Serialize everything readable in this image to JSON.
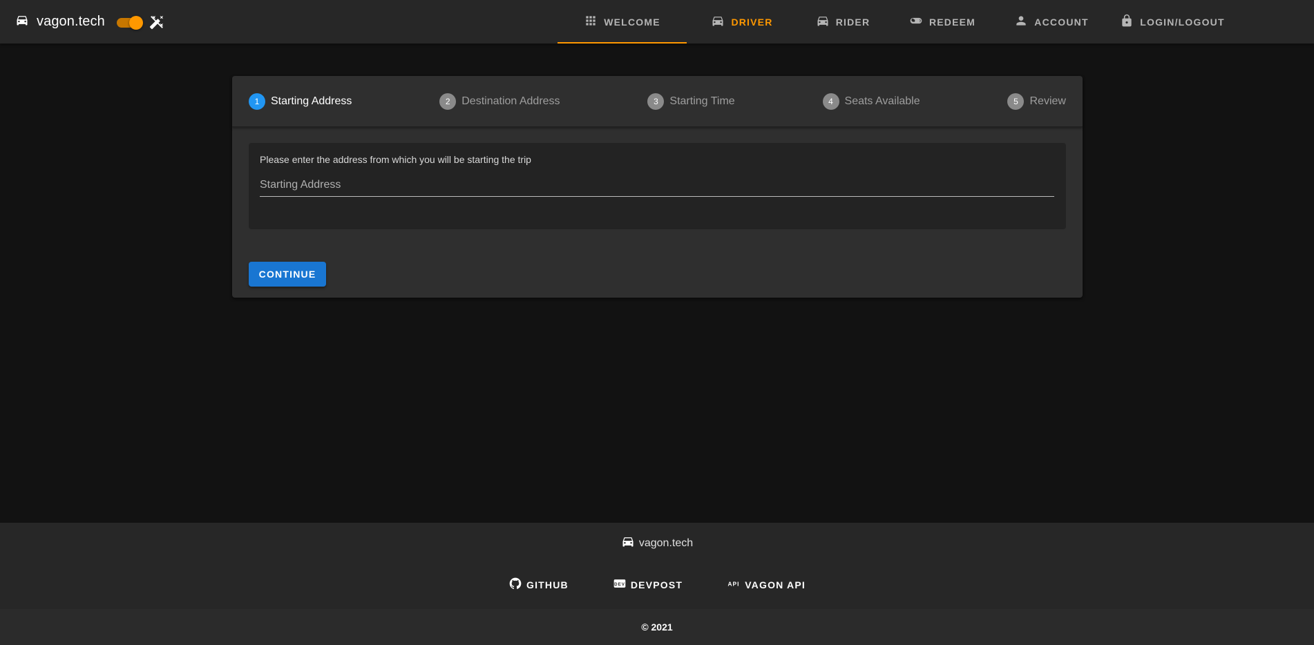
{
  "app": {
    "brand": "vagon.tech",
    "accent_color": "#ff9800",
    "primary_color": "#1976d2"
  },
  "nav": {
    "tabs": [
      {
        "label": "WELCOME",
        "icon": "grid-icon"
      },
      {
        "label": "DRIVER",
        "icon": "car-icon",
        "selected": true
      },
      {
        "label": "RIDER",
        "icon": "car-icon"
      },
      {
        "label": "REDEEM",
        "icon": "toggle-icon"
      },
      {
        "label": "ACCOUNT",
        "icon": "person-icon"
      },
      {
        "label": "LOGIN/LOGOUT",
        "icon": "lock-icon"
      }
    ]
  },
  "stepper": {
    "steps": [
      {
        "num": "1",
        "label": "Starting Address",
        "active": true
      },
      {
        "num": "2",
        "label": "Destination Address"
      },
      {
        "num": "3",
        "label": "Starting Time"
      },
      {
        "num": "4",
        "label": "Seats Available"
      },
      {
        "num": "5",
        "label": "Review"
      }
    ],
    "instruction": "Please enter the address from which you will be starting the trip",
    "input_placeholder": "Starting Address",
    "input_value": "",
    "continue_label": "CONTINUE"
  },
  "footer": {
    "brand": "vagon.tech",
    "links": [
      {
        "label": "GITHUB",
        "icon": "github-icon"
      },
      {
        "label": "DEVPOST",
        "icon": "devpost-icon"
      },
      {
        "label": "VAGON API",
        "icon": "api-icon"
      }
    ],
    "copyright": "© 2021"
  }
}
